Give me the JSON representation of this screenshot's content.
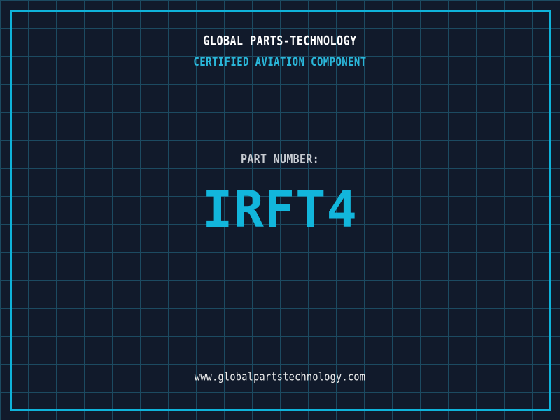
{
  "theme": {
    "background-color": "#111a2b",
    "grid-color": "#1c4a61",
    "frame-color": "#0fb3da",
    "title-color": "#ffffff",
    "tagline-color": "#2ab7da",
    "label-color": "#c7cbd1",
    "part-number-color": "#12b6dc",
    "url-color": "#f0f0f0"
  },
  "header": {
    "company_name": "GLOBAL PARTS-TECHNOLOGY",
    "tagline": "CERTIFIED AVIATION COMPONENT"
  },
  "part": {
    "label": "PART NUMBER:",
    "number": "IRFT4"
  },
  "footer": {
    "website": "www.globalpartstechnology.com"
  }
}
